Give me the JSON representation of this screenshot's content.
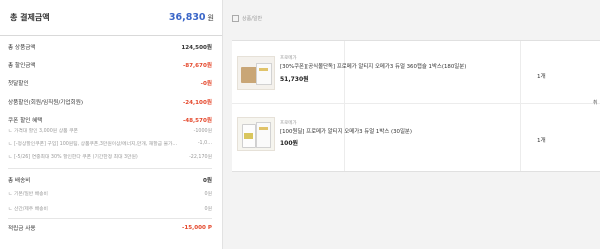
{
  "summary": {
    "title": "총 결제금액",
    "total_value": "36,830",
    "total_unit": "원",
    "rows": [
      {
        "label": "총 상품금액",
        "value": "124,500원"
      },
      {
        "label": "총 할인금액",
        "value": "-87,670원"
      },
      {
        "label": "첫달할인",
        "value": "-0원"
      },
      {
        "label": "상품할인(회원/임직원/기업회원)",
        "value": "-24,100원"
      },
      {
        "label": "쿠폰 할인 혜택",
        "value": "-48,570원"
      },
      {
        "label": "ㄴ 가격대 할인 3,000원 상품 쿠폰",
        "value": "-1000원"
      },
      {
        "label": "ㄴ [-정상할인쿠폰] 구입] 100원팀, 상품쿠폰,3만원이상/에너지,만개, 재할금 불가…",
        "value": "-1,0…"
      },
      {
        "label": "ㄴ [-5/26] 연중최대 30% 할인한다 쿠폰 (기간한정 최대 3만원)",
        "value": "-22,170원"
      },
      {
        "label": "총 배송비",
        "value": "0원"
      },
      {
        "label": "ㄴ 기본/일반 배송비",
        "value": "0원"
      },
      {
        "label": "ㄴ 산간/제주 배송비",
        "value": "0원"
      },
      {
        "label": "적립금 사용",
        "value": "-15,000 P"
      }
    ]
  },
  "search": {
    "label": "상품/일반"
  },
  "items": [
    {
      "brand": "프로메가",
      "name": "[30%쿠폰][공식몰단독] 프로메가 알티지 오메가3 듀얼 360캡슐 1박스(180일분)",
      "price": "51,730원",
      "qty": "1개"
    },
    {
      "brand": "프로메가",
      "name": "[100원딜] 프로메가 알티지 오메가3 듀얼 1박스 (30일분)",
      "price": "100원",
      "qty": "1개"
    }
  ],
  "edge_label": "취"
}
